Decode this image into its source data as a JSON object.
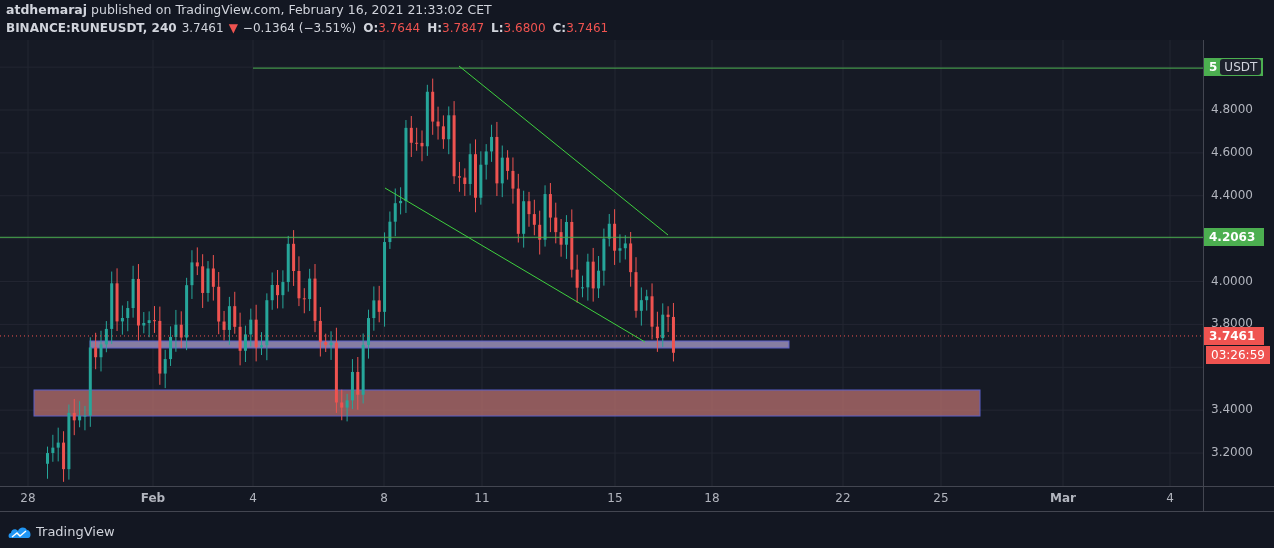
{
  "header": {
    "byline": "**atdhemaraj** published on TradingView.com, February 16, 2021 21:33:02 CET",
    "symbol": "BINANCE:RUNEUSDT, 240",
    "last": "3.7461",
    "arrow": "▼",
    "change": "−0.1364 (−3.51%)",
    "ohlc": [
      {
        "label": "O:",
        "value": "3.7644"
      },
      {
        "label": "H:",
        "value": "3.7847"
      },
      {
        "label": "L:",
        "value": "3.6800"
      },
      {
        "label": "C:",
        "value": "3.7461"
      }
    ]
  },
  "price_axis": {
    "ticks": [
      "4.8000",
      "4.6000",
      "4.4000",
      "4.0000",
      "3.8000",
      "3.4000",
      "3.2000"
    ],
    "badges": [
      {
        "kind": "level",
        "text": "5",
        "color": "#4caf50",
        "currency": "USDT"
      },
      {
        "kind": "level",
        "text": "4.2063",
        "color": "#4caf50"
      },
      {
        "kind": "price",
        "text": "3.7461",
        "color": "#ef5350"
      },
      {
        "kind": "timer",
        "text": "03:26:59",
        "color": "#ef5350"
      }
    ]
  },
  "time_axis": {
    "labels": [
      {
        "text": "28",
        "major": false
      },
      {
        "text": "Feb",
        "major": true
      },
      {
        "text": "4",
        "major": false
      },
      {
        "text": "8",
        "major": false
      },
      {
        "text": "11",
        "major": false
      },
      {
        "text": "15",
        "major": false
      },
      {
        "text": "18",
        "major": false
      },
      {
        "text": "22",
        "major": false
      },
      {
        "text": "25",
        "major": false
      },
      {
        "text": "Mar",
        "major": true
      },
      {
        "text": "4",
        "major": false
      }
    ]
  },
  "footer": {
    "brand": "TradingView"
  }
}
